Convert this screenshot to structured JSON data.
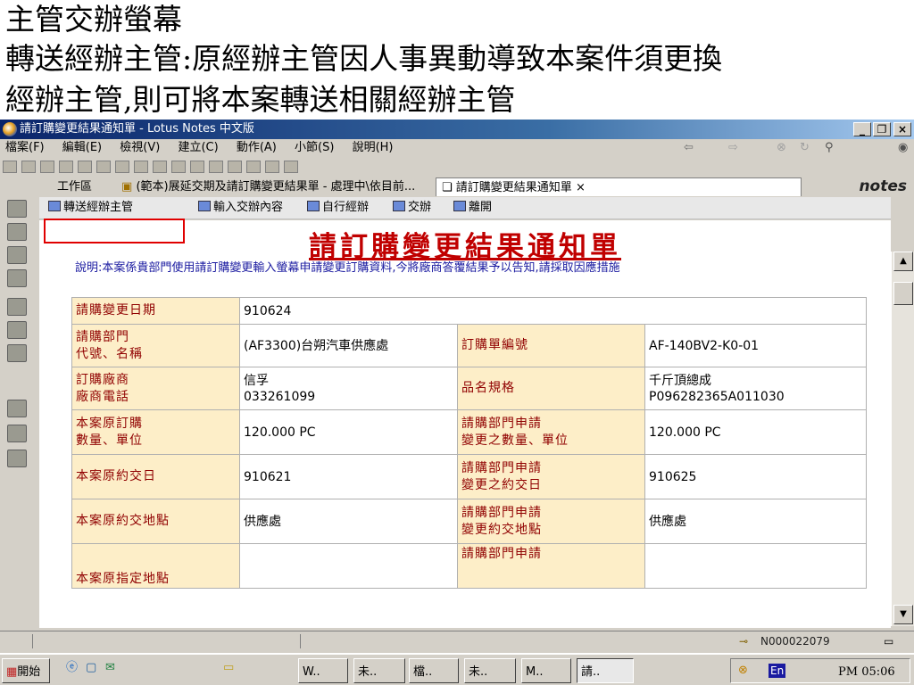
{
  "caption": {
    "line1": "主管交辦螢幕",
    "line2": "轉送經辦主管:原經辦主管因人事異動導致本案件須更換",
    "line3": "經辦主管,則可將本案轉送相關經辦主管"
  },
  "window": {
    "title": "請訂購變更結果通知單 - Lotus Notes 中文版",
    "menu": [
      "檔案(F)",
      "編輯(E)",
      "檢視(V)",
      "建立(C)",
      "動作(A)",
      "小節(S)",
      "說明(H)"
    ],
    "tabs": [
      "工作區",
      "(範本)展延交期及請訂購變更結果單 - 處理中\\依目前...",
      "請訂購變更結果通知單"
    ],
    "tab_close": "×",
    "brand": "notes"
  },
  "actions": [
    "轉送經辦主管",
    "輸入交辦內容",
    "自行經辦",
    "交辦",
    "離開"
  ],
  "document": {
    "title": "請訂購變更結果通知單",
    "description": "說明:本案係貴部門使用請訂購變更輸入螢幕申請變更訂購資料,今將廠商答覆結果予以告知,請採取因應措施",
    "fields": {
      "change_date_label": "請購變更日期",
      "change_date": "910624",
      "dept_label_1": "請購部門",
      "dept_label_2": "代號、名稱",
      "dept": "(AF3300)台朔汽車供應處",
      "po_no_label": "訂購單編號",
      "po_no": "AF-140BV2-K0-01",
      "vendor_label_1": "訂購廠商",
      "vendor_label_2": "廠商電話",
      "vendor_name": "信孚",
      "vendor_phone": "033261099",
      "spec_label": "品名規格",
      "spec_1": "千斤頂總成",
      "spec_2": "P096282365A011030",
      "orig_qty_label_1": "本案原訂購",
      "orig_qty_label_2": "數量、單位",
      "orig_qty": "120.000 PC",
      "req_qty_label_1": "請購部門申請",
      "req_qty_label_2": "變更之數量、單位",
      "req_qty": "120.000 PC",
      "orig_date_label": "本案原約交日",
      "orig_date": "910621",
      "req_date_label_1": "請購部門申請",
      "req_date_label_2": "變更之約交日",
      "req_date": "910625",
      "orig_place_label": "本案原約交地點",
      "orig_place": "供應處",
      "req_place_label_1": "請購部門申請",
      "req_place_label_2": "變更約交地點",
      "req_place": "供應處",
      "orig_spec_place_label": "本案原指定地點",
      "req_spec_place_label": "請購部門申請"
    }
  },
  "status": {
    "id": "N000022079"
  },
  "taskbar": {
    "start": "開始",
    "buttons": [
      "W..",
      "未..",
      "檔..",
      "未..",
      "M..",
      "請.."
    ],
    "ime": "En",
    "clock": "PM 05:06"
  }
}
